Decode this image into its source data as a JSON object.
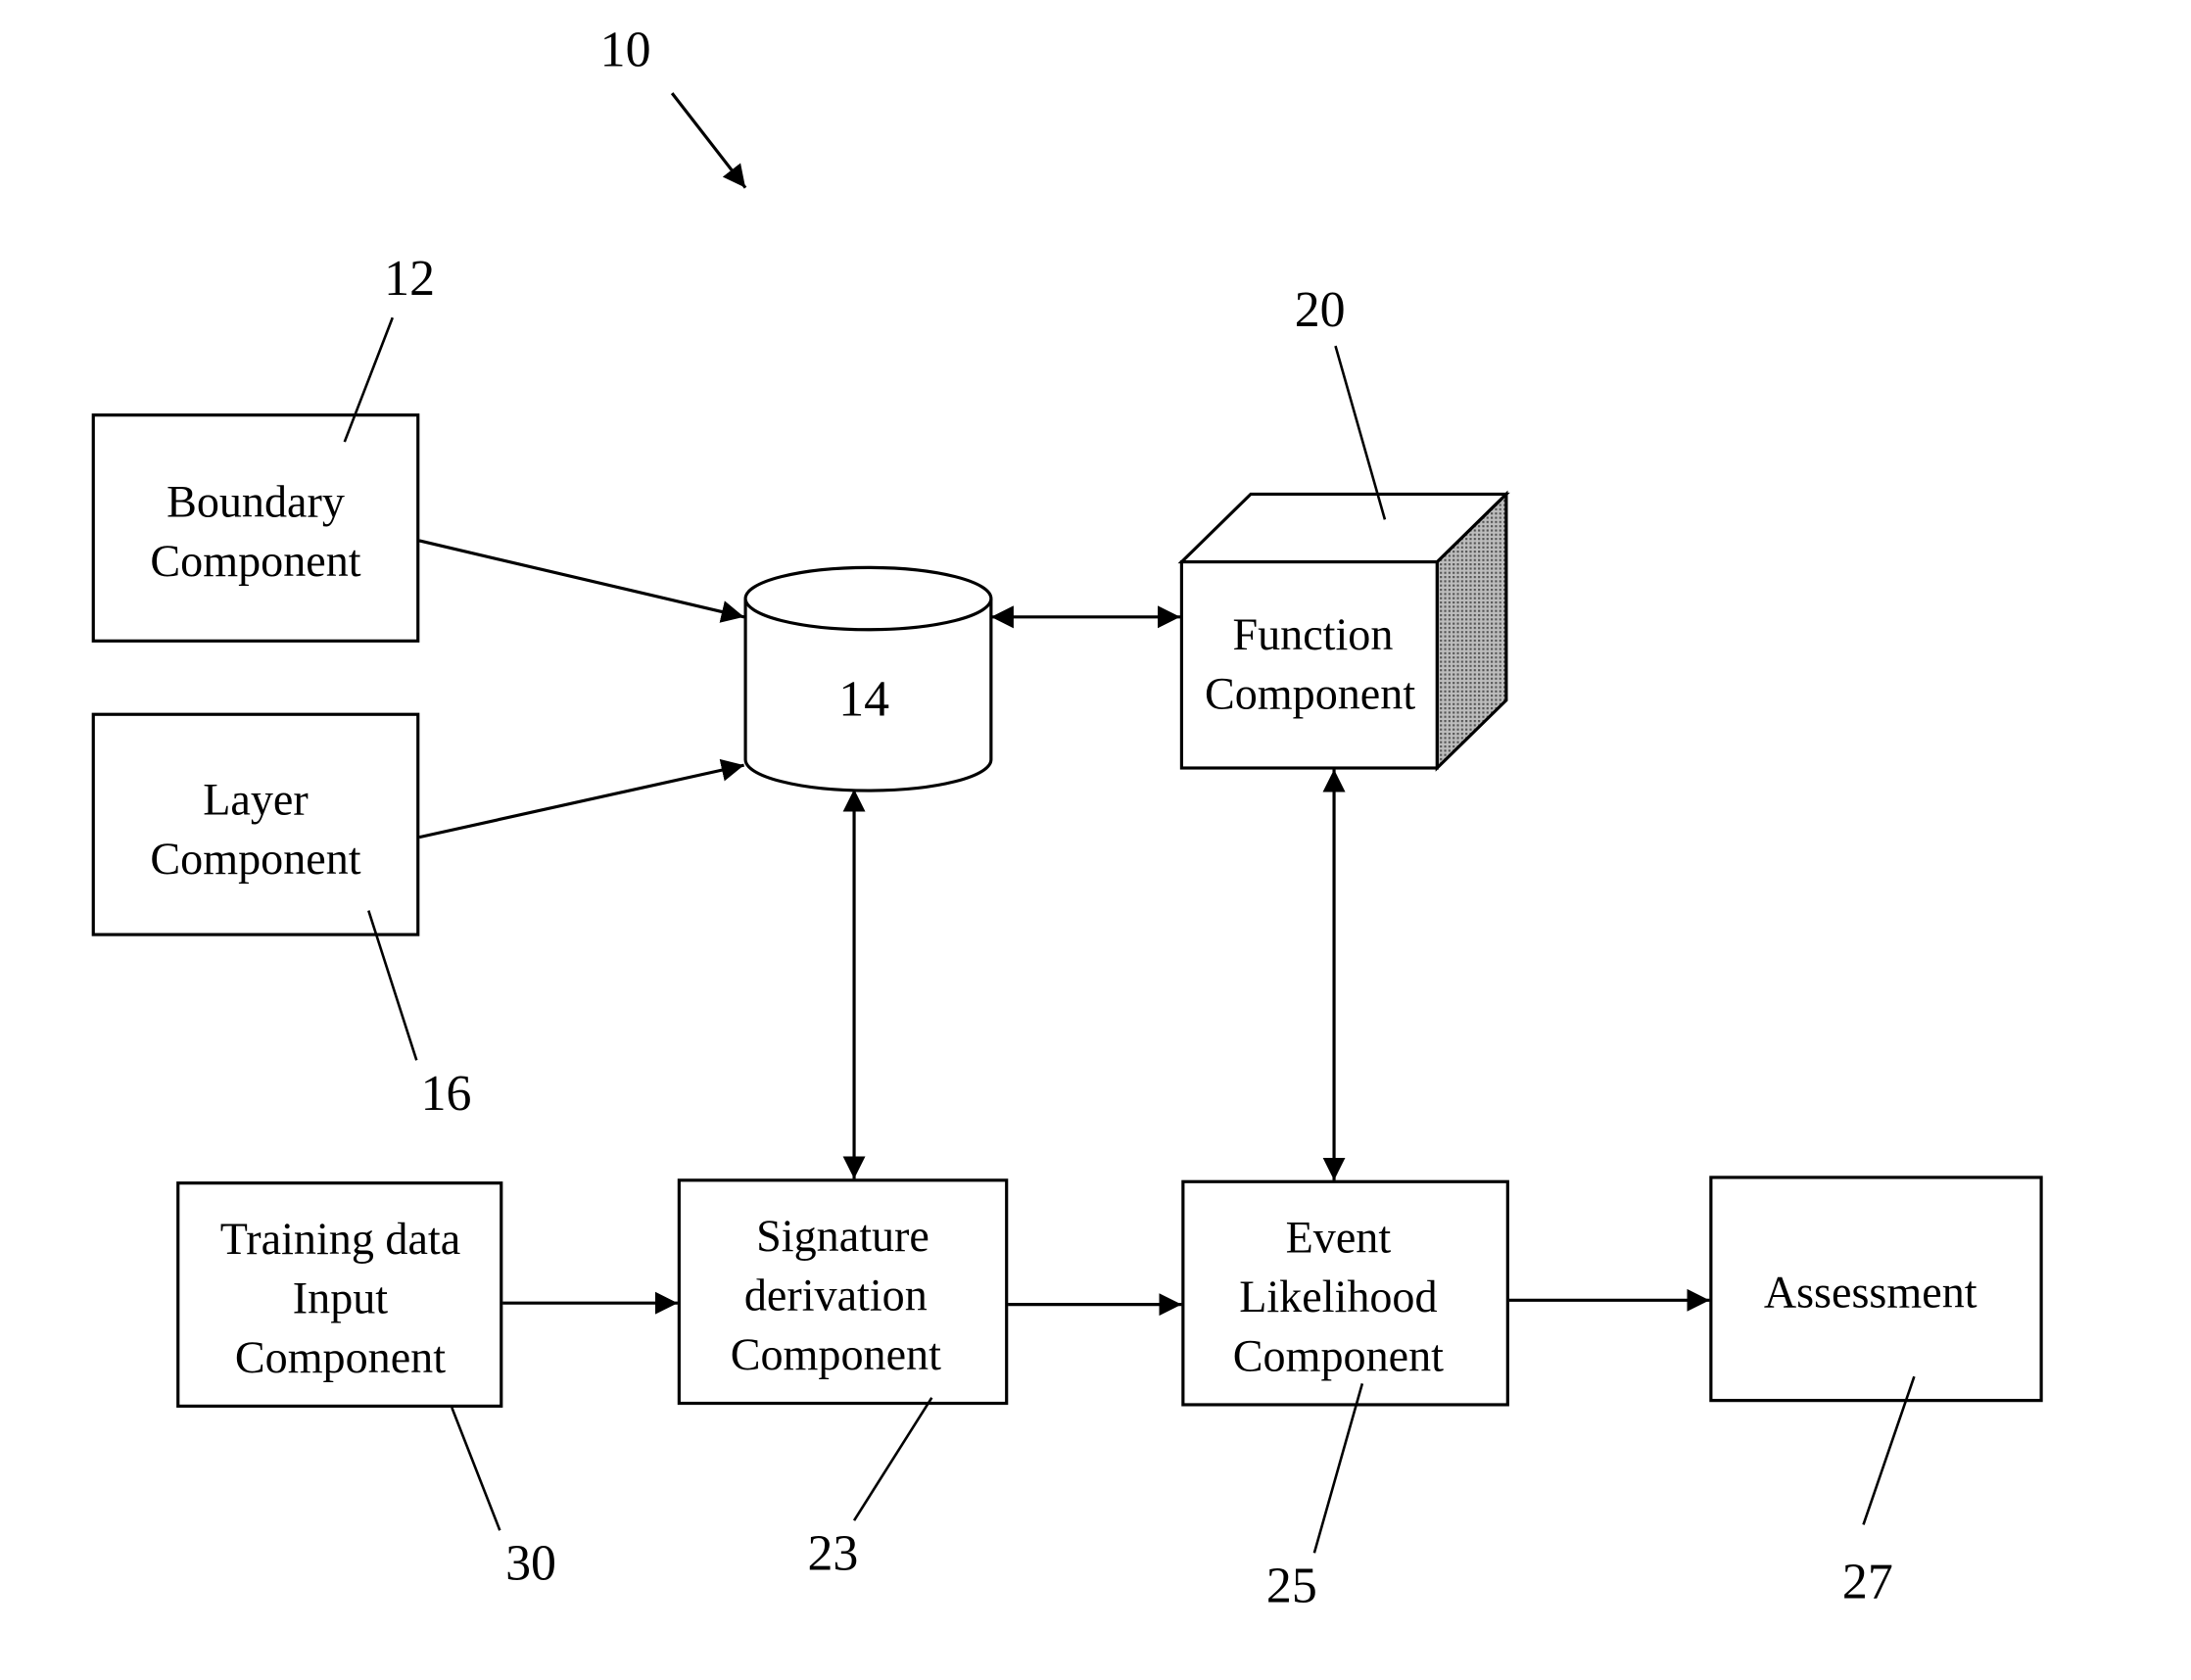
{
  "figure": {
    "ref": "10",
    "components": {
      "boundary": {
        "ref": "12",
        "lines": [
          "Boundary",
          "Component"
        ]
      },
      "database": {
        "ref": "14"
      },
      "layer": {
        "ref": "16",
        "lines": [
          "Layer",
          "Component"
        ]
      },
      "function": {
        "ref": "20",
        "lines": [
          "Function",
          "Component"
        ]
      },
      "signature": {
        "ref": "23",
        "lines": [
          "Signature",
          "derivation",
          "Component"
        ]
      },
      "event": {
        "ref": "25",
        "lines": [
          "Event",
          "Likelihood",
          "Component"
        ]
      },
      "assessment": {
        "ref": "27",
        "lines": [
          "Assessment"
        ]
      },
      "training": {
        "ref": "30",
        "lines": [
          "Training data",
          "Input",
          "Component"
        ]
      }
    },
    "connections": [
      {
        "from": "boundary",
        "to": "database",
        "type": "one-way"
      },
      {
        "from": "layer",
        "to": "database",
        "type": "one-way"
      },
      {
        "from": "database",
        "to": "function",
        "type": "two-way"
      },
      {
        "from": "database",
        "to": "signature",
        "type": "two-way"
      },
      {
        "from": "function",
        "to": "event",
        "type": "two-way"
      },
      {
        "from": "training",
        "to": "signature",
        "type": "one-way"
      },
      {
        "from": "signature",
        "to": "event",
        "type": "one-way"
      },
      {
        "from": "event",
        "to": "assessment",
        "type": "one-way"
      }
    ],
    "colors": {
      "ink": "#000000",
      "background": "#ffffff",
      "shade": "#8a8a8a"
    }
  }
}
